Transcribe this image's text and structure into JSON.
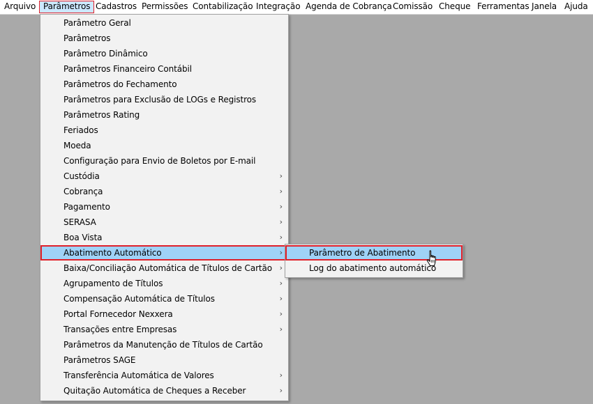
{
  "menubar": {
    "items": [
      {
        "label": "Arquivo"
      },
      {
        "label": "Parâmetros"
      },
      {
        "label": "Cadastros"
      },
      {
        "label": "Permissões"
      },
      {
        "label": "Contabilização"
      },
      {
        "label": "Integração"
      },
      {
        "label": "Agenda de Cobrança"
      },
      {
        "label": "Comissão"
      },
      {
        "label": "Cheque"
      },
      {
        "label": "Ferramentas"
      },
      {
        "label": "Janela"
      },
      {
        "label": "Ajuda"
      }
    ],
    "active_index": 1
  },
  "parametros_menu": {
    "items": [
      {
        "label": "Parâmetro Geral",
        "has_submenu": false
      },
      {
        "label": "Parâmetros",
        "has_submenu": false
      },
      {
        "label": "Parâmetro Dinâmico",
        "has_submenu": false
      },
      {
        "label": "Parâmetros Financeiro Contábil",
        "has_submenu": false
      },
      {
        "label": "Parâmetros do Fechamento",
        "has_submenu": false
      },
      {
        "label": "Parâmetros para Exclusão de LOGs e Registros",
        "has_submenu": false
      },
      {
        "label": "Parâmetros Rating",
        "has_submenu": false
      },
      {
        "label": "Feriados",
        "has_submenu": false
      },
      {
        "label": "Moeda",
        "has_submenu": false
      },
      {
        "label": "Configuração para Envio de Boletos por E-mail",
        "has_submenu": false
      },
      {
        "label": "Custódia",
        "has_submenu": true
      },
      {
        "label": "Cobrança",
        "has_submenu": true
      },
      {
        "label": "Pagamento",
        "has_submenu": true
      },
      {
        "label": "SERASA",
        "has_submenu": true
      },
      {
        "label": "Boa Vista",
        "has_submenu": true
      },
      {
        "label": "Abatimento Automático",
        "has_submenu": true
      },
      {
        "label": "Baixa/Conciliação Automática de Títulos de Cartão",
        "has_submenu": true
      },
      {
        "label": "Agrupamento de Títulos",
        "has_submenu": true
      },
      {
        "label": "Compensação Automática de Títulos",
        "has_submenu": true
      },
      {
        "label": "Portal Fornecedor Nexxera",
        "has_submenu": true
      },
      {
        "label": "Transações entre Empresas",
        "has_submenu": true
      },
      {
        "label": "Parâmetros da Manutenção de Títulos de Cartão",
        "has_submenu": false
      },
      {
        "label": "Parâmetros SAGE",
        "has_submenu": false
      },
      {
        "label": "Transferência Automática de Valores",
        "has_submenu": true
      },
      {
        "label": "Quitação Automática de Cheques a Receber",
        "has_submenu": true
      }
    ],
    "highlighted_index": 15,
    "submenu_arrow_glyph": "›"
  },
  "abatimento_submenu": {
    "items": [
      {
        "label": "Parâmetro de Abatimento"
      },
      {
        "label": "Log do abatimento automático"
      }
    ],
    "highlighted_index": 0
  },
  "colors": {
    "desktop_bg": "#a9a9a9",
    "menu_bg": "#f2f2f2",
    "highlight_bg": "#9fd2f7",
    "focus_border": "#e0202a"
  },
  "icons": {
    "cursor": "hand-pointer-icon",
    "submenu_arrow": "chevron-right-icon"
  }
}
